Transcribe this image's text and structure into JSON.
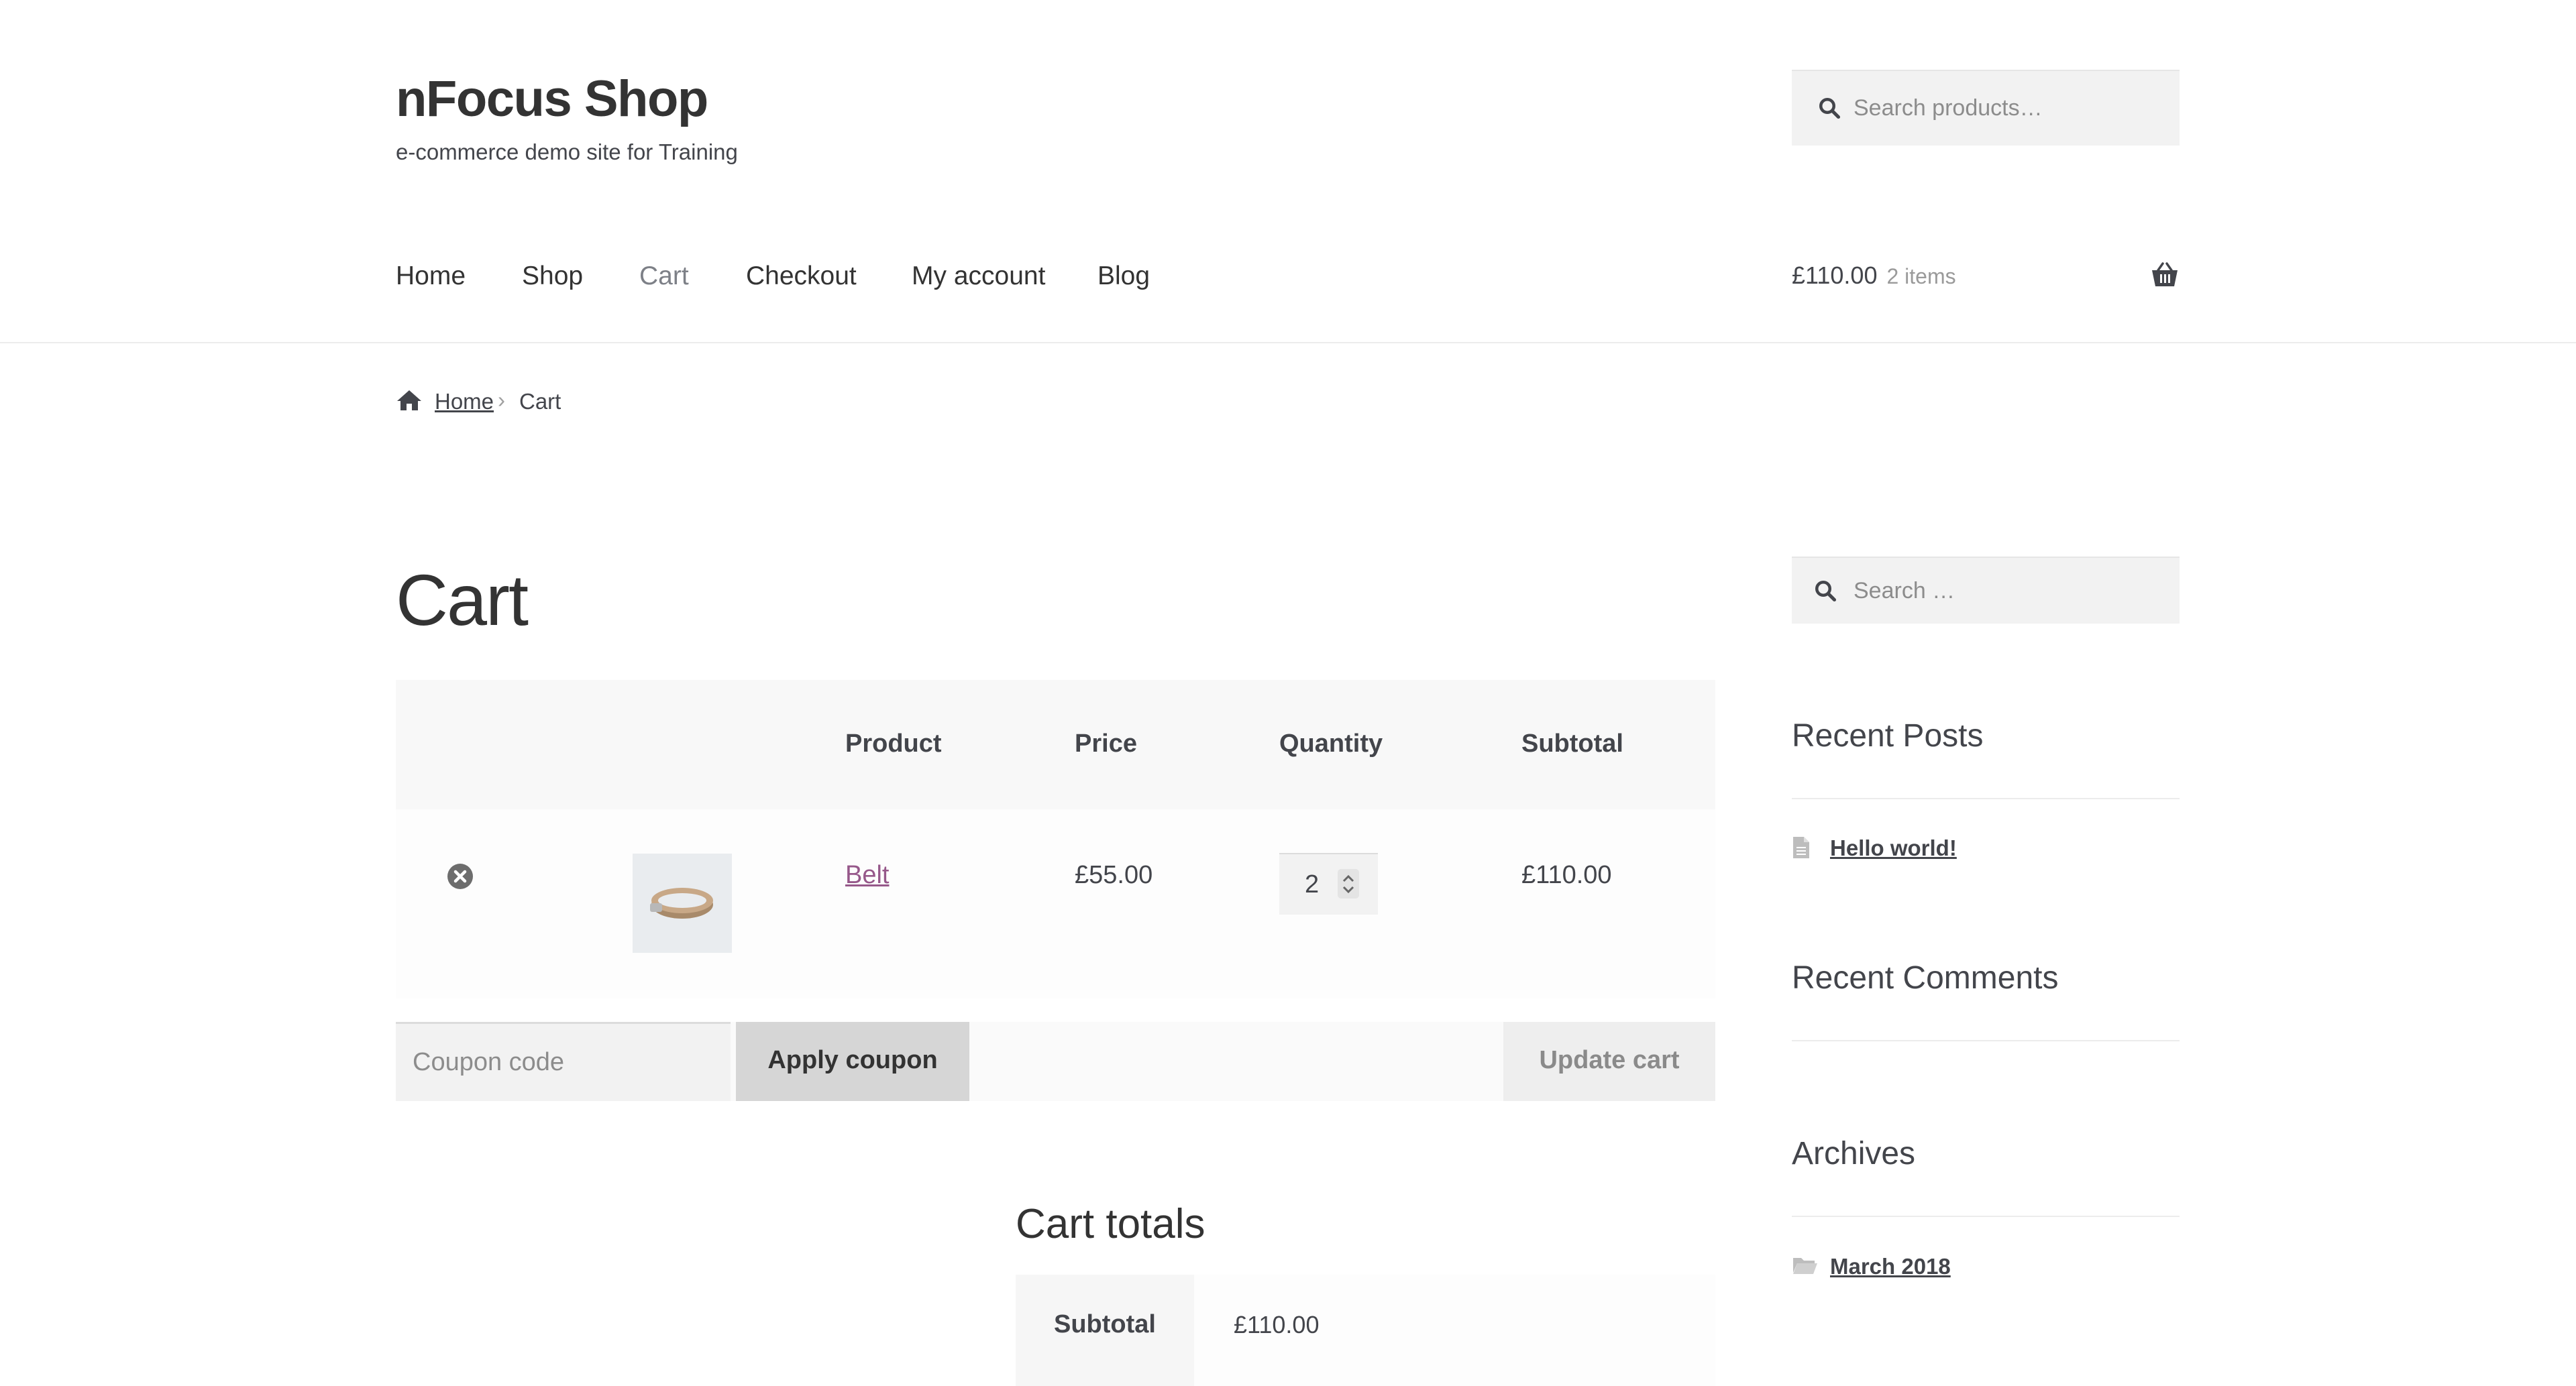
{
  "header": {
    "site_title": "nFocus Shop",
    "tagline": "e-commerce demo site for Training",
    "search_placeholder": "Search products…",
    "icons": {
      "search": "search-icon",
      "basket": "basket-icon"
    }
  },
  "nav": {
    "items": [
      {
        "label": "Home",
        "active": false
      },
      {
        "label": "Shop",
        "active": false
      },
      {
        "label": "Cart",
        "active": true
      },
      {
        "label": "Checkout",
        "active": false
      },
      {
        "label": "My account",
        "active": false
      },
      {
        "label": "Blog",
        "active": false
      }
    ]
  },
  "mini_cart": {
    "amount": "£110.00",
    "count": "2 items"
  },
  "breadcrumb": {
    "home": "Home",
    "current": "Cart",
    "separator": "›"
  },
  "page": {
    "title": "Cart"
  },
  "cart_table": {
    "headers": {
      "product": "Product",
      "price": "Price",
      "quantity": "Quantity",
      "subtotal": "Subtotal"
    },
    "rows": [
      {
        "product": "Belt",
        "price": "£55.00",
        "quantity": "2",
        "subtotal": "£110.00",
        "thumbnail": "belt-image"
      }
    ]
  },
  "actions": {
    "coupon_placeholder": "Coupon code",
    "apply_coupon": "Apply coupon",
    "update_cart": "Update cart"
  },
  "totals": {
    "title": "Cart totals",
    "subtotal_label": "Subtotal",
    "subtotal_value": "£110.00"
  },
  "sidebar": {
    "search_placeholder": "Search …",
    "recent_posts": {
      "title": "Recent Posts",
      "items": [
        "Hello world!"
      ]
    },
    "recent_comments": {
      "title": "Recent Comments"
    },
    "archives": {
      "title": "Archives",
      "items": [
        "March 2018"
      ]
    }
  },
  "colors": {
    "text": "#43454b",
    "heading": "#333333",
    "link_accent": "#96588a",
    "field_bg": "#f2f2f2",
    "button_bg": "#d6d6d6"
  }
}
